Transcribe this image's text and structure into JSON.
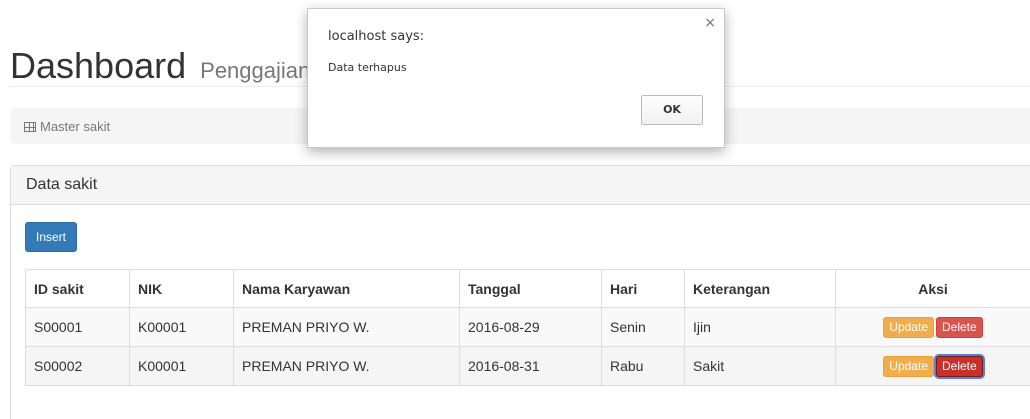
{
  "header": {
    "title": "Dashboard",
    "subtitle": "Penggajian"
  },
  "breadcrumb": {
    "icon": "table-icon",
    "label": "Master sakit"
  },
  "panel": {
    "title": "Data sakit",
    "insert_label": "Insert"
  },
  "table": {
    "columns": [
      "ID sakit",
      "NIK",
      "Nama Karyawan",
      "Tanggal",
      "Hari",
      "Keterangan",
      "Aksi"
    ],
    "rows": [
      {
        "id": "S00001",
        "nik": "K00001",
        "nama": "PREMAN PRIYO W.",
        "tanggal": "2016-08-29",
        "hari": "Senin",
        "keterangan": "Ijin"
      },
      {
        "id": "S00002",
        "nik": "K00001",
        "nama": "PREMAN PRIYO W.",
        "tanggal": "2016-08-31",
        "hari": "Rabu",
        "keterangan": "Sakit"
      }
    ],
    "update_label": "Update",
    "delete_label": "Delete"
  },
  "dialog": {
    "title": "localhost says:",
    "message": "Data terhapus",
    "ok_label": "OK",
    "close_label": "×"
  },
  "colors": {
    "primary": "#337ab7",
    "warning": "#f0ad4e",
    "danger": "#d9534f"
  }
}
